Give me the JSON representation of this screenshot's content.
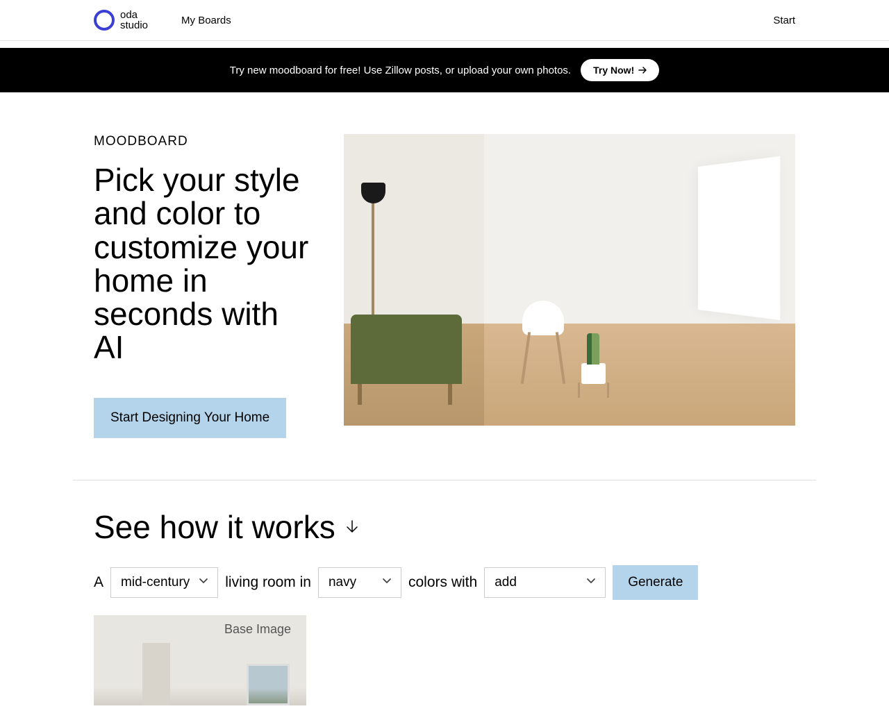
{
  "header": {
    "logo_line1": "oda",
    "logo_line2": "studio",
    "nav_my_boards": "My Boards",
    "start": "Start"
  },
  "banner": {
    "text": "Try new moodboard for free! Use Zillow posts, or upload your own photos.",
    "cta": "Try Now!"
  },
  "hero": {
    "label": "MOODBOARD",
    "title": "Pick your style and color to customize your home in seconds with AI",
    "cta": "Start Designing Your Home"
  },
  "howit": {
    "title": "See how it works",
    "prefix_a": "A",
    "style_value": "mid-century",
    "middle_text": "living room in",
    "color_value": "navy",
    "colors_with": "colors with",
    "accent_value": "add",
    "generate": "Generate"
  },
  "base_image": {
    "label": "Base Image"
  }
}
